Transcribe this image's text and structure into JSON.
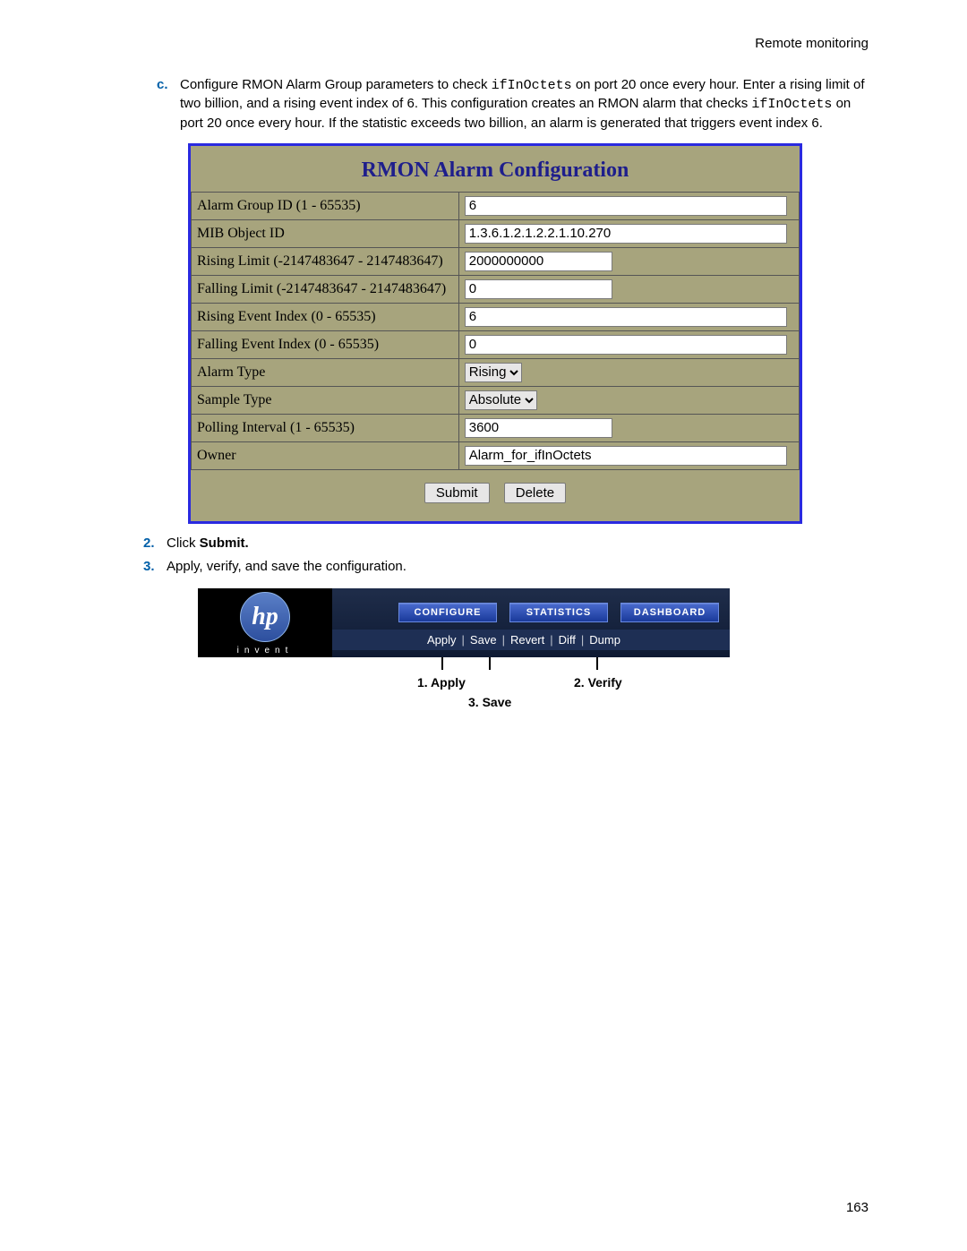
{
  "header": "Remote monitoring",
  "intro": {
    "marker": "c.",
    "text_prefix": "Configure RMON Alarm Group parameters to check ",
    "code1": "ifInOctets",
    "text_mid1": " on port 20 once every hour. Enter a rising limit of two billion, and a rising event index of 6. This configuration creates an RMON alarm that checks ",
    "code2": "ifInOctets",
    "text_mid2": " on port 20 once every hour. If the statistic exceeds two billion, an alarm is generated that triggers event index 6."
  },
  "config": {
    "title": "RMON Alarm Configuration",
    "rows": {
      "alarm_group": {
        "label": "Alarm Group ID (1 - 65535)",
        "value": "6"
      },
      "mib": {
        "label": "MIB Object ID",
        "value": "1.3.6.1.2.1.2.2.1.10.270"
      },
      "rising_lim": {
        "label": "Rising Limit (-2147483647 - 2147483647)",
        "value": "2000000000"
      },
      "falling_lim": {
        "label": "Falling Limit (-2147483647 - 2147483647)",
        "value": "0"
      },
      "rising_idx": {
        "label": "Rising Event Index (0 - 65535)",
        "value": "6"
      },
      "falling_idx": {
        "label": "Falling Event Index (0 - 65535)",
        "value": "0"
      },
      "alarm_type": {
        "label": "Alarm Type",
        "value": "Rising"
      },
      "sample_type": {
        "label": "Sample Type",
        "value": "Absolute"
      },
      "poll": {
        "label": "Polling Interval (1 - 65535)",
        "value": "3600"
      },
      "owner": {
        "label": "Owner",
        "value": "Alarm_for_ifInOctets"
      }
    },
    "buttons": {
      "submit": "Submit",
      "delete": "Delete"
    }
  },
  "step2": {
    "marker": "2.",
    "text": "Click ",
    "bold": "Submit."
  },
  "step3": {
    "marker": "3.",
    "text": "Apply, verify, and save the configuration."
  },
  "toolbar": {
    "logo_text": "hp",
    "invent": "invent",
    "tabs": {
      "configure": "CONFIGURE",
      "statistics": "STATISTICS",
      "dashboard": "DASHBOARD"
    },
    "links": {
      "apply": "Apply",
      "save": "Save",
      "revert": "Revert",
      "diff": "Diff",
      "dump": "Dump"
    },
    "labels": {
      "apply": "1. Apply",
      "verify": "2. Verify",
      "save": "3. Save"
    }
  },
  "page_number": "163"
}
